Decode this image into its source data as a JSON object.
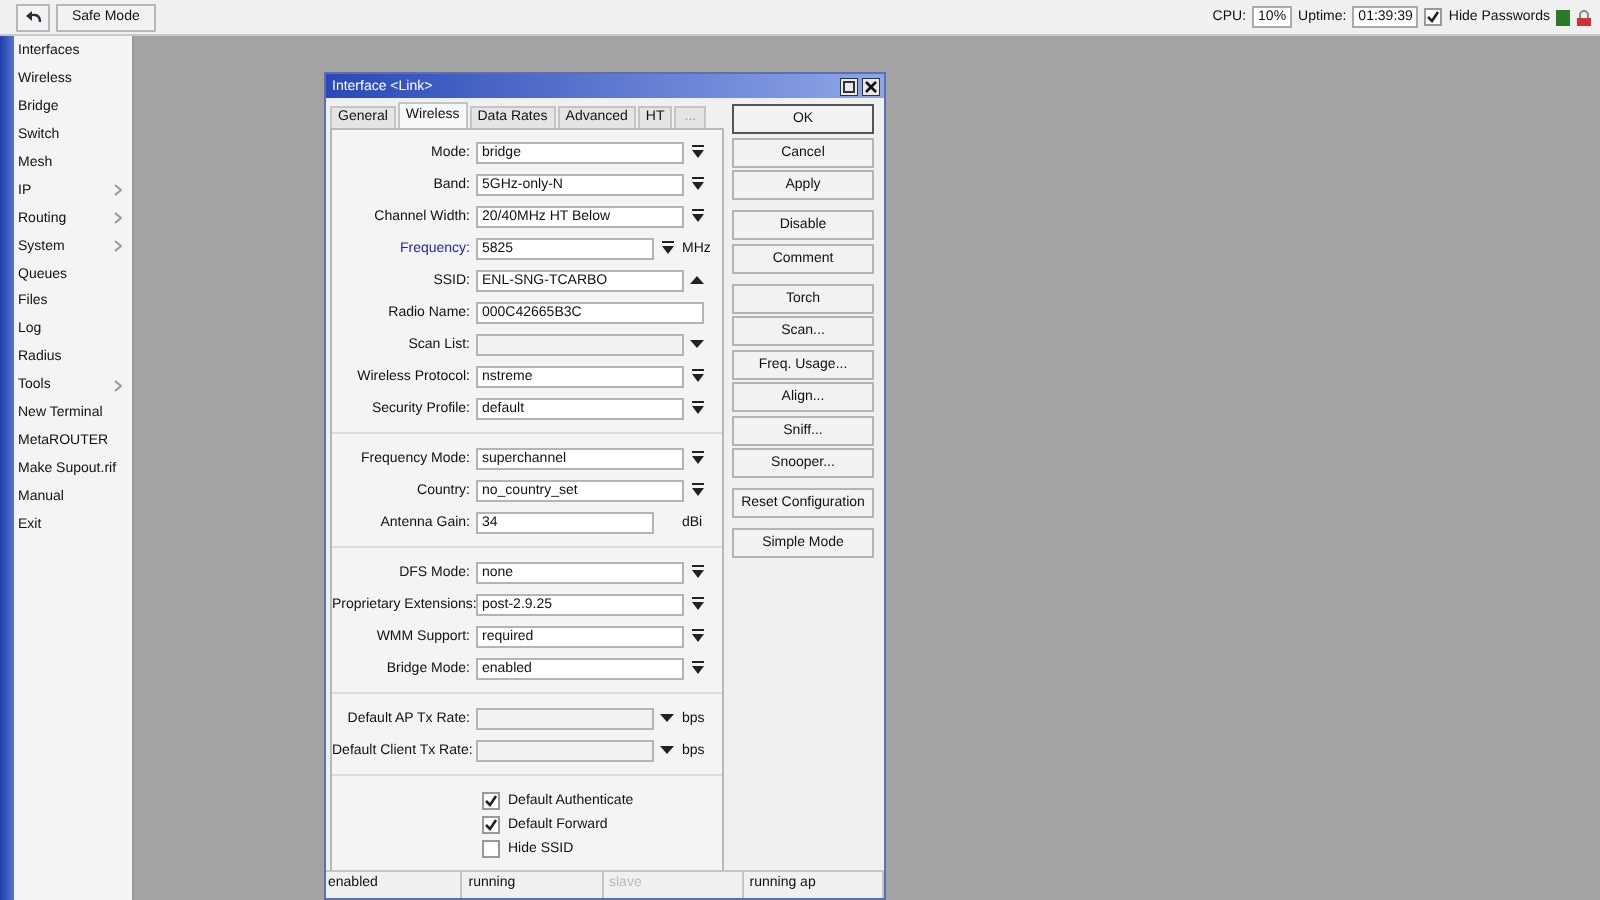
{
  "toolbar": {
    "safe_mode": "Safe Mode",
    "cpu_label": "CPU:",
    "cpu": "10%",
    "uptime_label": "Uptime:",
    "uptime": "01:39:39",
    "hide_passwords": {
      "label": "Hide Passwords",
      "checked": true
    }
  },
  "sidebar": {
    "items": [
      {
        "label": "Interfaces",
        "submenu": false
      },
      {
        "label": "Wireless",
        "submenu": false
      },
      {
        "label": "Bridge",
        "submenu": false
      },
      {
        "label": "Switch",
        "submenu": false
      },
      {
        "label": "Mesh",
        "submenu": false
      },
      {
        "label": "IP",
        "submenu": true
      },
      {
        "label": "Routing",
        "submenu": true
      },
      {
        "label": "System",
        "submenu": true
      },
      {
        "label": "Queues",
        "submenu": false
      },
      {
        "label": "Files",
        "submenu": false
      },
      {
        "label": "Log",
        "submenu": false
      },
      {
        "label": "Radius",
        "submenu": false
      },
      {
        "label": "Tools",
        "submenu": true
      },
      {
        "label": "New Terminal",
        "submenu": false
      },
      {
        "label": "MetaROUTER",
        "submenu": false
      },
      {
        "label": "Make Supout.rif",
        "submenu": false
      },
      {
        "label": "Manual",
        "submenu": false
      },
      {
        "label": "Exit",
        "submenu": false
      }
    ]
  },
  "dialog": {
    "title": "Interface <Link>",
    "tabs": [
      {
        "label": "General",
        "selected": false
      },
      {
        "label": "Wireless",
        "selected": true
      },
      {
        "label": "Data Rates",
        "selected": false
      },
      {
        "label": "Advanced",
        "selected": false
      },
      {
        "label": "HT",
        "selected": false
      },
      {
        "label": "...",
        "selected": false
      }
    ],
    "sections": [
      {
        "fields": [
          {
            "label": "Mode:",
            "kind": "select",
            "value": "bridge",
            "highlighted": false
          },
          {
            "label": "Band:",
            "kind": "select",
            "value": "5GHz-only-N",
            "highlighted": false
          },
          {
            "label": "Channel Width:",
            "kind": "select",
            "value": "20/40MHz HT Below",
            "highlighted": false
          },
          {
            "label": "Frequency:",
            "kind": "select",
            "value": "5825",
            "unit": "MHz",
            "highlighted": true
          },
          {
            "label": "SSID:",
            "kind": "collapse",
            "value": "ENL-SNG-TCARBO",
            "highlighted": false
          },
          {
            "label": "Radio Name:",
            "kind": "text",
            "value": "000C42665B3C",
            "highlighted": false
          },
          {
            "label": "Scan List:",
            "kind": "combo",
            "highlighted": false
          },
          {
            "label": "Wireless Protocol:",
            "kind": "select",
            "value": "nstreme",
            "highlighted": false
          },
          {
            "label": "Security Profile:",
            "kind": "select",
            "value": "default",
            "highlighted": false
          }
        ]
      },
      {
        "fields": [
          {
            "label": "Frequency Mode:",
            "kind": "select",
            "value": "superchannel",
            "highlighted": false
          },
          {
            "label": "Country:",
            "kind": "select",
            "value": "no_country_set",
            "highlighted": false
          },
          {
            "label": "Antenna Gain:",
            "kind": "text",
            "value": "34",
            "unit": "dBi",
            "highlighted": false
          }
        ]
      },
      {
        "fields": [
          {
            "label": "DFS Mode:",
            "kind": "select",
            "value": "none",
            "highlighted": false
          },
          {
            "label": "Proprietary Extensions:",
            "kind": "select",
            "value": "post-2.9.25",
            "highlighted": false
          },
          {
            "label": "WMM Support:",
            "kind": "select",
            "value": "required",
            "highlighted": false
          },
          {
            "label": "Bridge Mode:",
            "kind": "select",
            "value": "enabled",
            "highlighted": false
          }
        ]
      },
      {
        "fields": [
          {
            "label": "Default AP Tx Rate:",
            "kind": "combo",
            "unit": "bps",
            "highlighted": false
          },
          {
            "label": "Default Client Tx Rate:",
            "kind": "combo",
            "unit": "bps",
            "highlighted": false
          }
        ]
      }
    ],
    "checkboxes": [
      {
        "label": "Default Authenticate",
        "checked": true
      },
      {
        "label": "Default Forward",
        "checked": true
      },
      {
        "label": "Hide SSID",
        "checked": false
      }
    ],
    "button_groups": [
      [
        {
          "label": "OK",
          "default": true
        },
        {
          "label": "Cancel",
          "default": false
        },
        {
          "label": "Apply",
          "default": false
        }
      ],
      [
        {
          "label": "Disable",
          "default": false
        },
        {
          "label": "Comment",
          "default": false
        }
      ],
      [
        {
          "label": "Torch",
          "default": false
        },
        {
          "label": "Scan...",
          "default": false
        },
        {
          "label": "Freq. Usage...",
          "default": false
        },
        {
          "label": "Align...",
          "default": false
        },
        {
          "label": "Sniff...",
          "default": false
        },
        {
          "label": "Snooper...",
          "default": false
        }
      ],
      [
        {
          "label": "Reset Configuration",
          "default": false
        }
      ],
      [
        {
          "label": "Simple Mode",
          "default": false
        }
      ]
    ],
    "status": [
      {
        "text": "enabled",
        "disabled": false
      },
      {
        "text": "running",
        "disabled": false
      },
      {
        "text": "slave",
        "disabled": true
      },
      {
        "text": "running ap",
        "disabled": false
      }
    ]
  }
}
